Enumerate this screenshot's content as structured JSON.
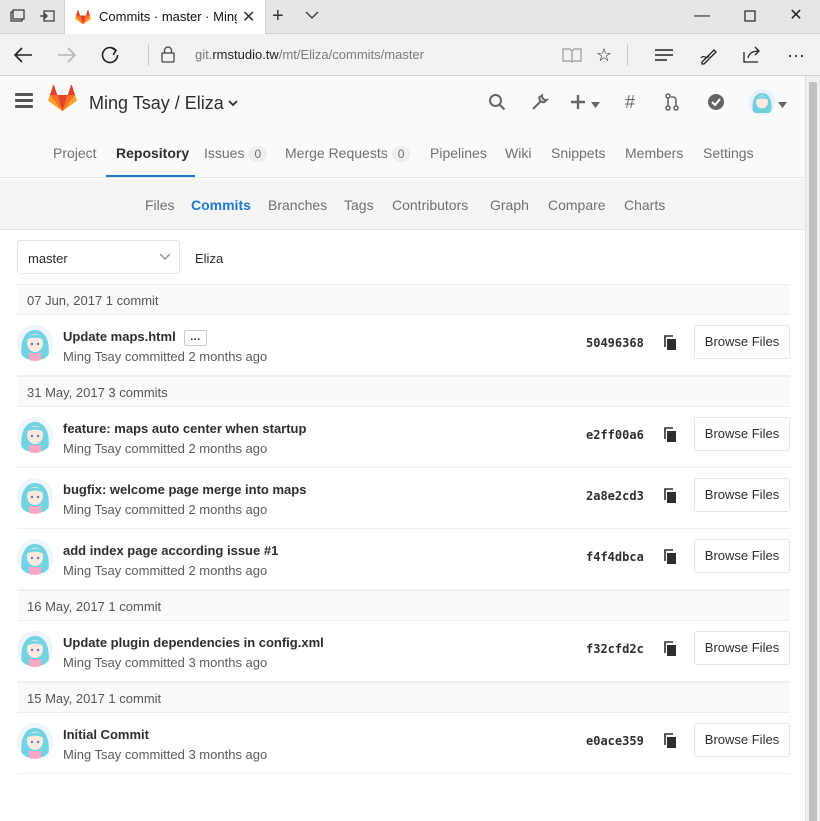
{
  "browser": {
    "tab_title": "Commits · master · Ming Tsay / Eliza",
    "url_prefix": "git.",
    "url_domain": "rmstudio.tw",
    "url_path": "/mt/Eliza/commits/master"
  },
  "header": {
    "project_title": "Ming Tsay / Eliza"
  },
  "project_nav": {
    "items": [
      {
        "label": "Project"
      },
      {
        "label": "Repository"
      },
      {
        "label": "Issues",
        "count": "0"
      },
      {
        "label": "Merge Requests",
        "count": "0"
      },
      {
        "label": "Pipelines"
      },
      {
        "label": "Wiki"
      },
      {
        "label": "Snippets"
      },
      {
        "label": "Members"
      },
      {
        "label": "Settings"
      }
    ]
  },
  "sub_nav": {
    "items": [
      {
        "label": "Files"
      },
      {
        "label": "Commits"
      },
      {
        "label": "Branches"
      },
      {
        "label": "Tags"
      },
      {
        "label": "Contributors"
      },
      {
        "label": "Graph"
      },
      {
        "label": "Compare"
      },
      {
        "label": "Charts"
      }
    ]
  },
  "controls": {
    "branch": "master",
    "repo_name": "Eliza"
  },
  "commits": {
    "browse_label": "Browse Files",
    "days": [
      {
        "header": "07 Jun, 2017 1 commit",
        "items": [
          {
            "title": "Update maps.html",
            "has_more": true,
            "meta": "Ming Tsay committed 2 months ago",
            "sha": "50496368"
          }
        ]
      },
      {
        "header": "31 May, 2017 3 commits",
        "items": [
          {
            "title": "feature: maps auto center when startup",
            "meta": "Ming Tsay committed 2 months ago",
            "sha": "e2ff00a6"
          },
          {
            "title": "bugfix: welcome page merge into maps",
            "meta": "Ming Tsay committed 2 months ago",
            "sha": "2a8e2cd3"
          },
          {
            "title": "add index page according issue #1",
            "meta": "Ming Tsay committed 2 months ago",
            "sha": "f4f4dbca"
          }
        ]
      },
      {
        "header": "16 May, 2017 1 commit",
        "items": [
          {
            "title": "Update plugin dependencies in config.xml",
            "meta": "Ming Tsay committed 3 months ago",
            "sha": "f32cfd2c"
          }
        ]
      },
      {
        "header": "15 May, 2017 1 commit",
        "items": [
          {
            "title": "Initial Commit",
            "meta": "Ming Tsay committed 3 months ago",
            "sha": "e0ace359"
          }
        ]
      }
    ]
  },
  "colors": {
    "accent": "#1f78d1",
    "gitlab_orange": "#fc6d26"
  },
  "icons": [
    "tab-actions-icon",
    "set-aside-icon",
    "gitlab-favicon",
    "close-icon",
    "new-tab-icon",
    "tab-list-icon",
    "minimize-icon",
    "maximize-icon",
    "close-window-icon",
    "back-icon",
    "forward-icon",
    "refresh-icon",
    "lock-icon",
    "reading-view-icon",
    "favorite-star-icon",
    "hub-icon",
    "notes-icon",
    "share-icon",
    "more-icon",
    "hamburger-icon",
    "gitlab-logo",
    "search-icon",
    "wrench-icon",
    "plus-icon",
    "hash-icon",
    "merge-request-icon",
    "todo-check-icon",
    "copy-icon",
    "chevron-down-icon"
  ]
}
